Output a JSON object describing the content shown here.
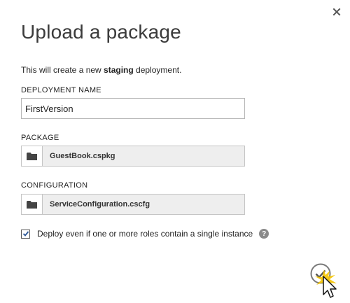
{
  "dialog": {
    "title": "Upload a package",
    "intro_prefix": "This will create a new ",
    "intro_emphasis": "staging",
    "intro_suffix": " deployment.",
    "close_icon": "close-icon"
  },
  "deployment_name": {
    "label": "DEPLOYMENT NAME",
    "value": "FirstVersion"
  },
  "package": {
    "label": "PACKAGE",
    "file": "GuestBook.cspkg",
    "icon": "folder-icon"
  },
  "configuration": {
    "label": "CONFIGURATION",
    "file": "ServiceConfiguration.cscfg",
    "icon": "folder-icon"
  },
  "options": {
    "deploy_single_instance": {
      "label": "Deploy even if one or more roles contain a single instance",
      "checked": true
    },
    "help_glyph": "?"
  },
  "actions": {
    "confirm_icon": "checkmark-icon"
  },
  "colors": {
    "accent": "#2b5797",
    "highlight": "#f5c400"
  }
}
